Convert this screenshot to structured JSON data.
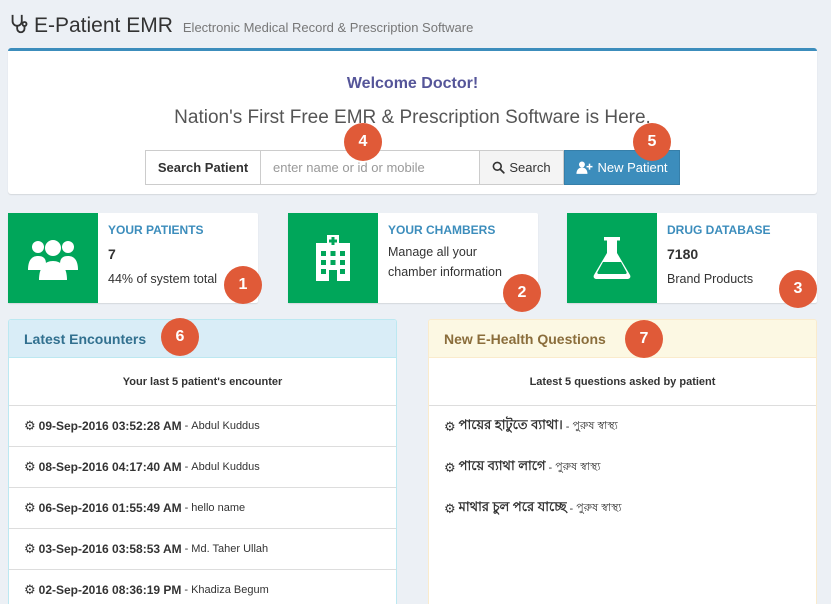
{
  "app": {
    "brand": "E-Patient EMR",
    "tagline": "Electronic Medical Record & Prescription Software",
    "logo_icon": "stethoscope-icon"
  },
  "welcome": {
    "title": "Welcome Doctor!",
    "subtitle": "Nation's First Free EMR & Prescription Software is Here.",
    "search_label": "Search Patient",
    "search_placeholder": "enter name or id or mobile",
    "search_value": "",
    "search_button": "Search",
    "new_patient_button": "New Patient"
  },
  "info_boxes": [
    {
      "label": "YOUR PATIENTS",
      "number": "7",
      "description": "44% of system total",
      "icon": "users-icon"
    },
    {
      "label": "YOUR CHAMBERS",
      "line1": "Manage all your",
      "line2": "chamber information",
      "icon": "hospital-icon"
    },
    {
      "label": "DRUG DATABASE",
      "number": "7180",
      "description": "Brand Products",
      "icon": "flask-icon"
    }
  ],
  "encounters": {
    "title": "Latest Encounters",
    "subtitle": "Your last 5 patient's encounter",
    "items": [
      {
        "date": "09-Sep-2016 03:52:28 AM",
        "name": "Abdul Kuddus"
      },
      {
        "date": "08-Sep-2016 04:17:40 AM",
        "name": "Abdul Kuddus"
      },
      {
        "date": "06-Sep-2016 01:55:49 AM",
        "name": "hello name"
      },
      {
        "date": "03-Sep-2016 03:58:53 AM",
        "name": "Md. Taher Ullah"
      },
      {
        "date": "02-Sep-2016 08:36:19 PM",
        "name": "Khadiza Begum"
      }
    ]
  },
  "questions": {
    "title": "New E-Health Questions",
    "subtitle": "Latest 5 questions asked by patient",
    "items": [
      {
        "question": "পায়ের হাটুতে ব্যাথা।",
        "category": "পুরুষ স্বাস্থ্য"
      },
      {
        "question": "পায়ে ব্যাথা লাগে",
        "category": "পুরুষ স্বাস্থ্য"
      },
      {
        "question": "মাথার চুল পরে যাচ্ছে",
        "category": "পুরুষ স্বাস্থ্য"
      }
    ]
  },
  "markers": [
    "1",
    "2",
    "3",
    "4",
    "5",
    "6",
    "7"
  ],
  "colors": {
    "primary": "#3c8dbc",
    "success": "#00a65a",
    "marker": "#e05a38",
    "welcome_title": "#555599"
  }
}
